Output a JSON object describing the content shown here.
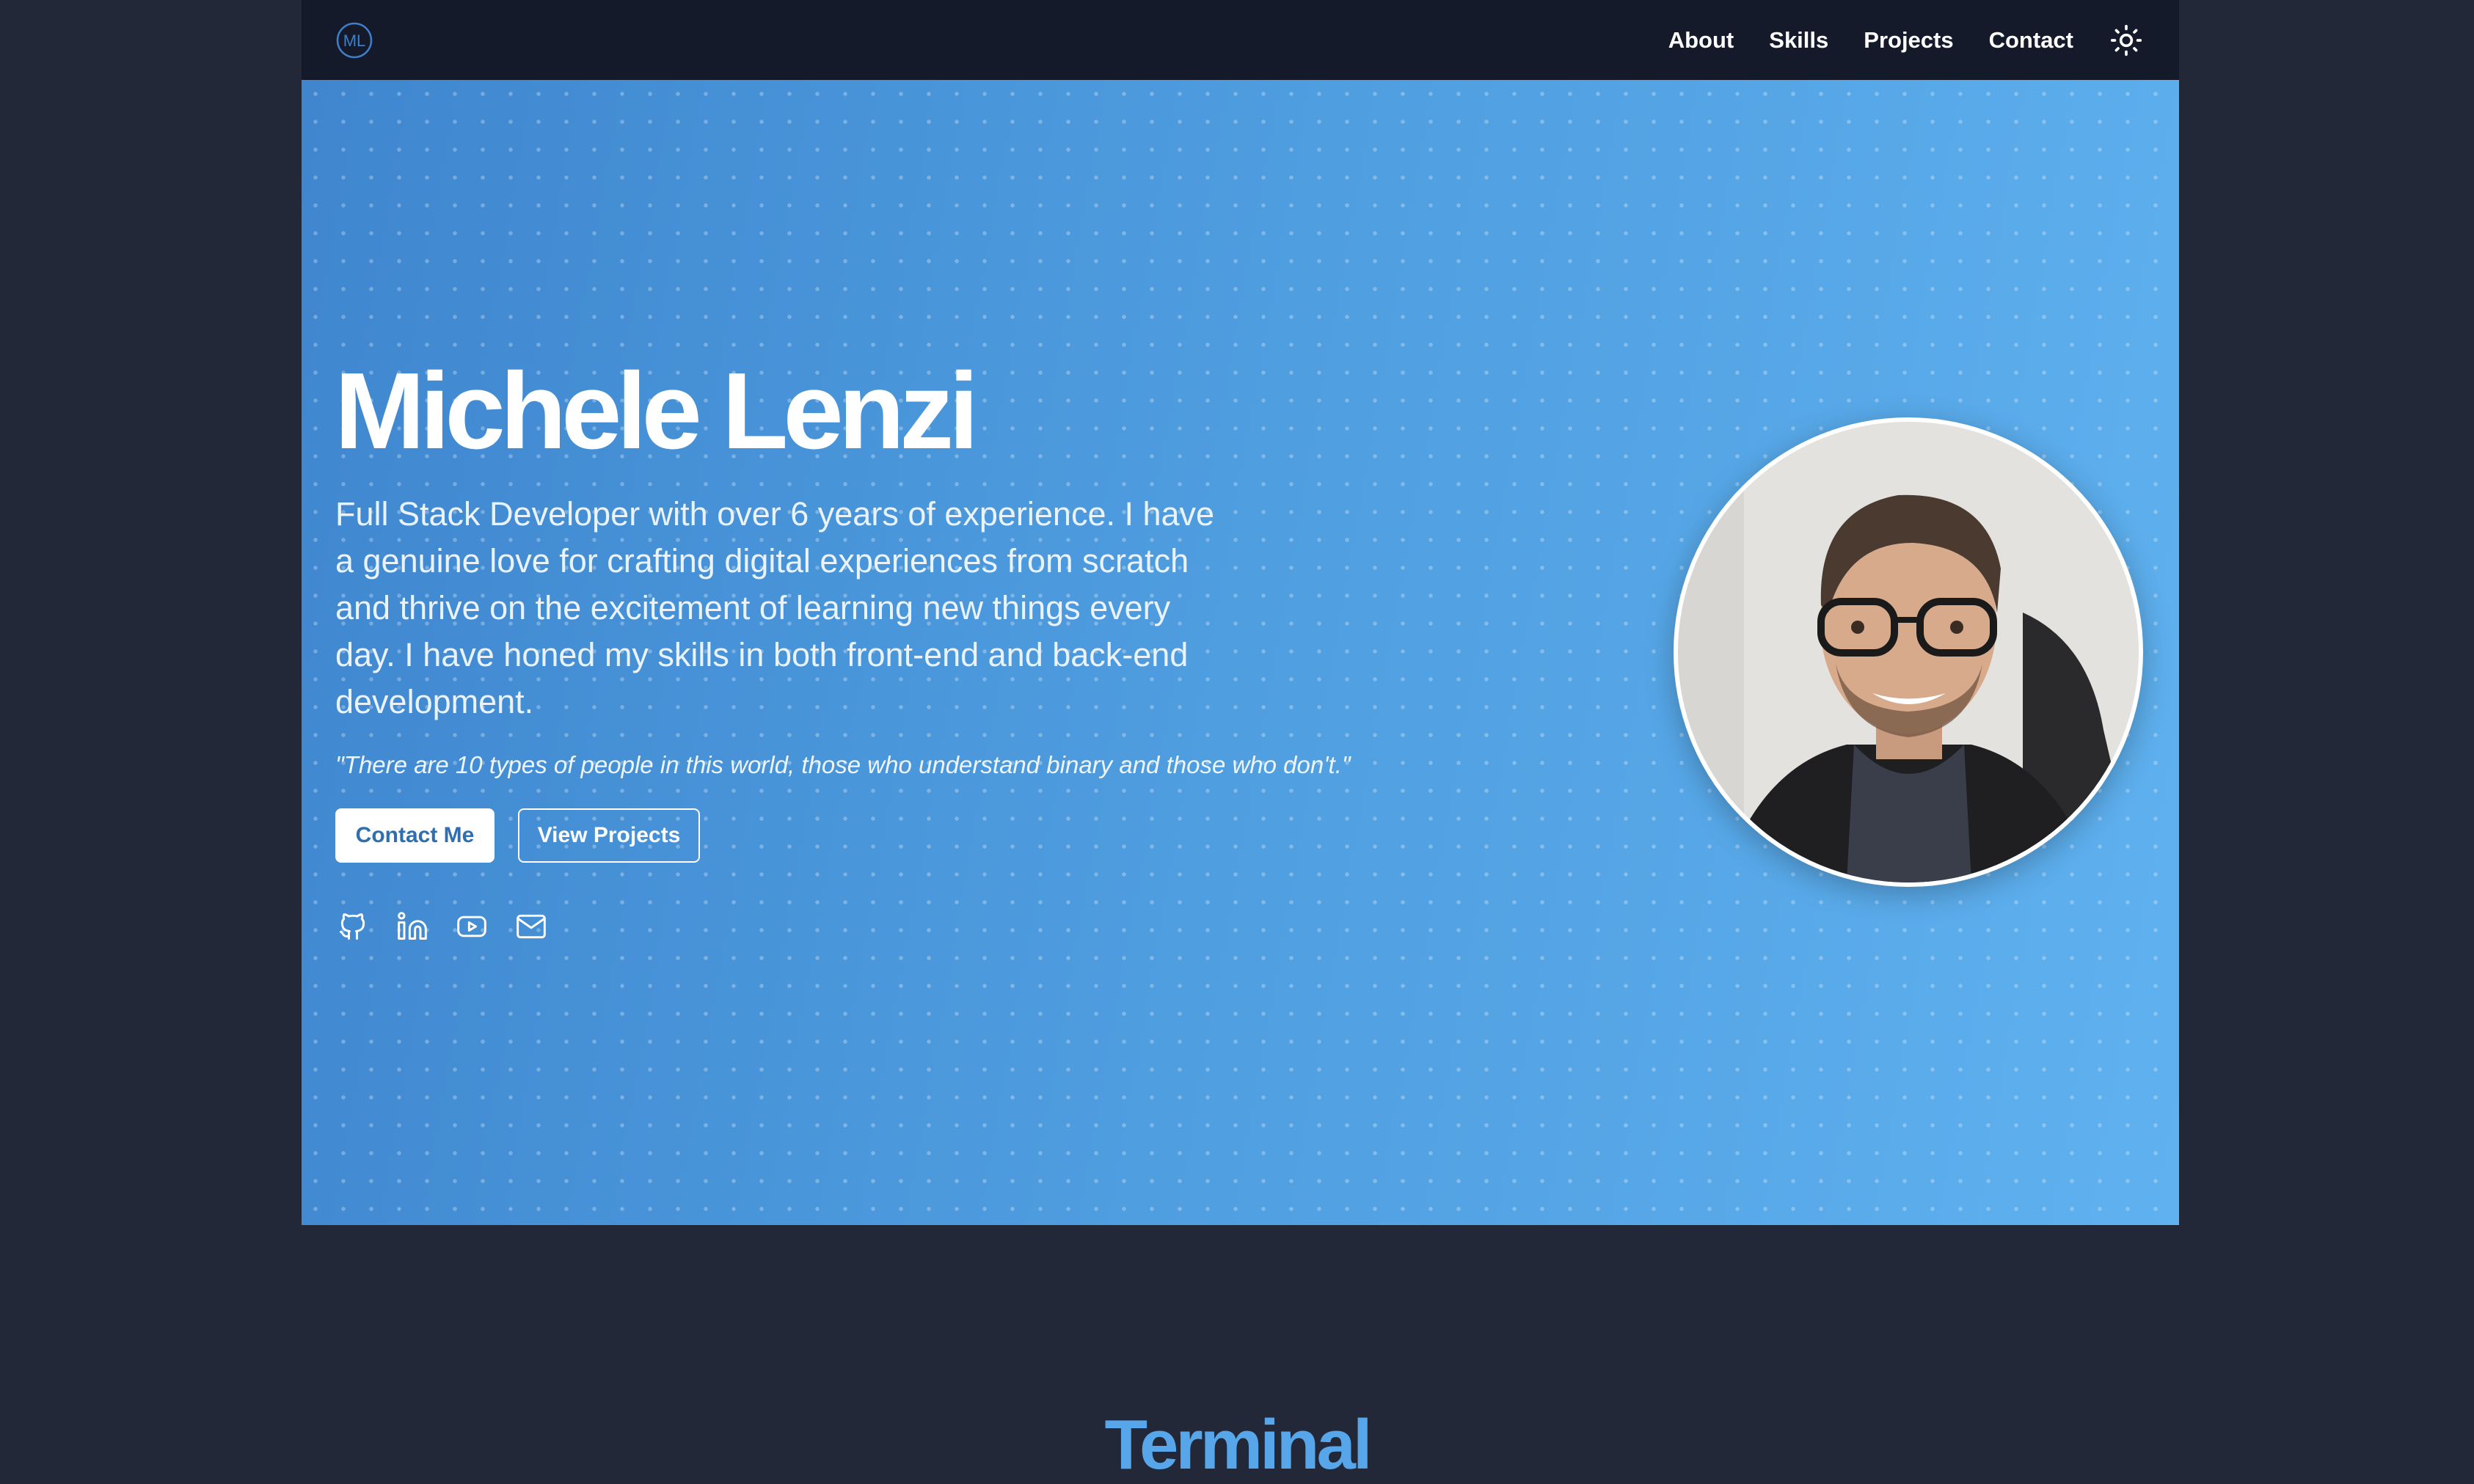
{
  "navbar": {
    "logo_text": "ML",
    "links": [
      {
        "label": "About"
      },
      {
        "label": "Skills"
      },
      {
        "label": "Projects"
      },
      {
        "label": "Contact"
      }
    ],
    "theme_toggle_icon": "sun-icon"
  },
  "hero": {
    "name": "Michele Lenzi",
    "description": "Full Stack Developer with over 6 years of experience. I have a genuine love for crafting digital experiences from scratch and thrive on the excitement of learning new things every day. I have honed my skills in both front-end and back-end development.",
    "quote": "\"There are 10 types of people in this world, those who understand binary and those who don't.\"",
    "buttons": {
      "contact": "Contact Me",
      "projects": "View Projects"
    },
    "social_icons": [
      "github-icon",
      "linkedin-icon",
      "youtube-icon",
      "mail-icon"
    ],
    "avatar": "profile-photo"
  },
  "next_section": {
    "title": "Terminal"
  },
  "colors": {
    "page_bg": "#222837",
    "navbar_bg": "#141a29",
    "hero_gradient_start": "#3f86cf",
    "hero_gradient_end": "#5fb1ef",
    "accent": "#58a6ea",
    "primary_button_text": "#2f6fb0"
  }
}
